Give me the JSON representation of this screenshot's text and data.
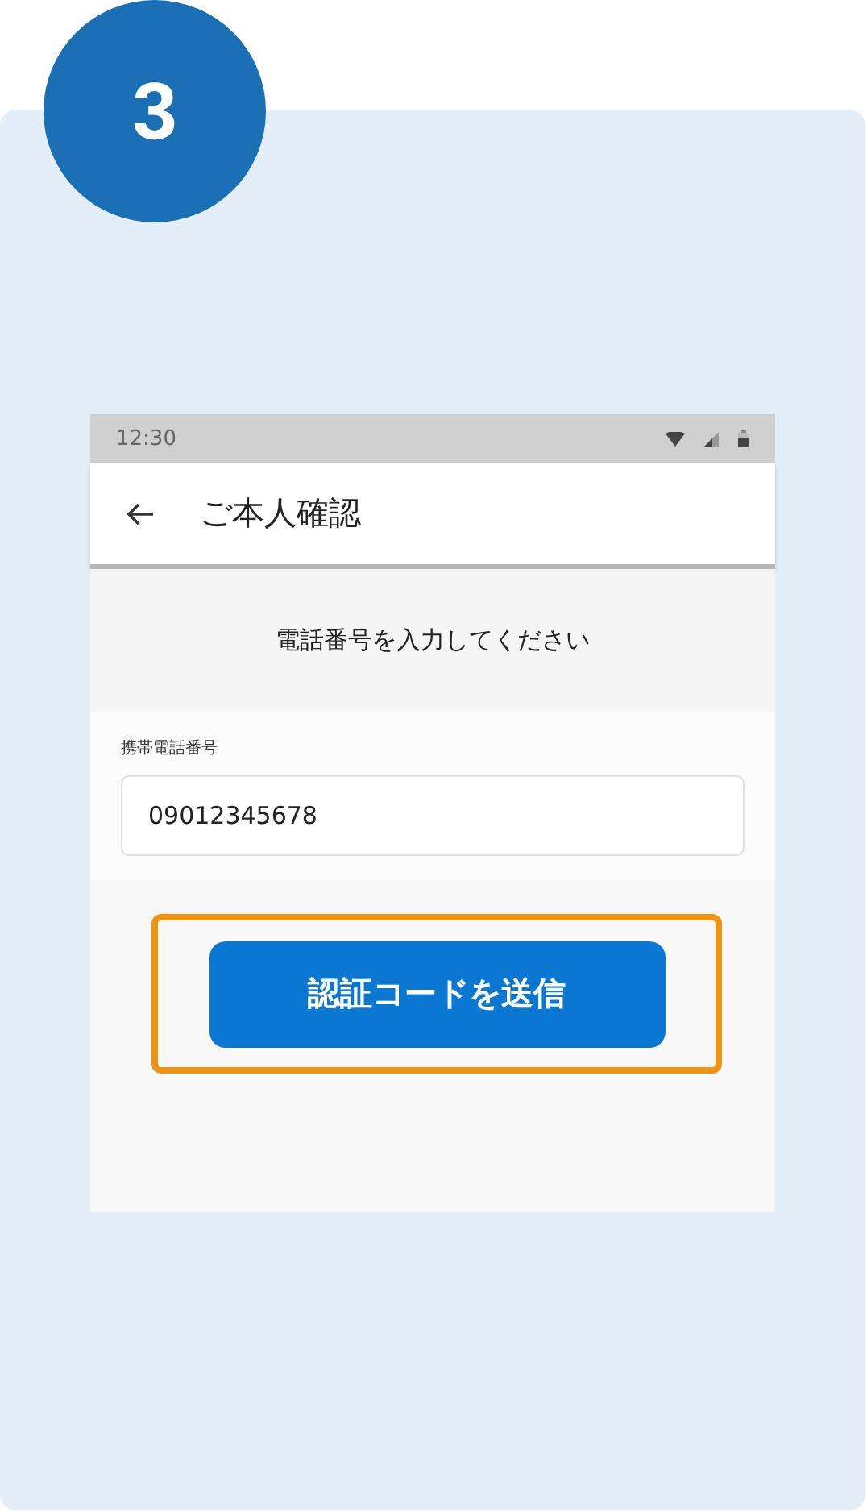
{
  "step": "3",
  "status_bar": {
    "time": "12:30"
  },
  "app_bar": {
    "title": "ご本人確認"
  },
  "instruction": "電話番号を入力してください",
  "field": {
    "label": "携帯電話番号",
    "value": "09012345678"
  },
  "button": {
    "label": "認証コードを送信",
    "highlighted": true
  }
}
